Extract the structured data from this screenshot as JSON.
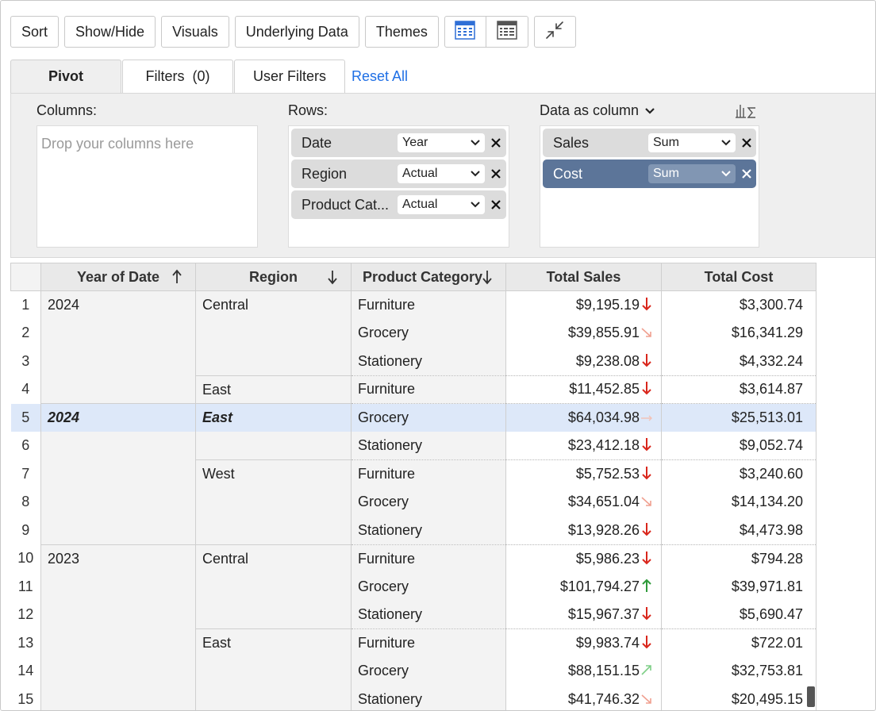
{
  "toolbar": {
    "sort": "Sort",
    "show_hide": "Show/Hide",
    "visuals": "Visuals",
    "underlying_data": "Underlying Data",
    "themes": "Themes",
    "icons": [
      "pivot-table-view-icon",
      "tabular-view-icon",
      "collapse-icon"
    ]
  },
  "tabs": {
    "pivot": "Pivot",
    "filters": "Filters  (0)",
    "user_filters": "User Filters",
    "reset_all": "Reset All"
  },
  "zones": {
    "columns_label": "Columns:",
    "columns_placeholder": "Drop your columns here",
    "rows_label": "Rows:",
    "rows": [
      {
        "name": "Date",
        "func": "Year"
      },
      {
        "name": "Region",
        "func": "Actual"
      },
      {
        "name": "Product Cat...",
        "func": "Actual"
      }
    ],
    "data_label": "Data as column",
    "data": [
      {
        "name": "Sales",
        "func": "Sum",
        "selected": false
      },
      {
        "name": "Cost",
        "func": "Sum",
        "selected": true
      }
    ]
  },
  "table": {
    "headers": [
      "Year of Date",
      "Region",
      "Product Category",
      "Total Sales",
      "Total Cost"
    ],
    "rows": [
      {
        "n": "1",
        "year": "2024",
        "region": "Central",
        "cat": "Furniture",
        "sales": "$9,195.19",
        "trend": "down",
        "cost": "$3,300.74"
      },
      {
        "n": "2",
        "year": "",
        "region": "",
        "cat": "Grocery",
        "sales": "$39,855.91",
        "trend": "slight-down",
        "cost": "$16,341.29"
      },
      {
        "n": "3",
        "year": "",
        "region": "",
        "cat": "Stationery",
        "sales": "$9,238.08",
        "trend": "down",
        "cost": "$4,332.24"
      },
      {
        "n": "4",
        "year": "",
        "region": "East",
        "cat": "Furniture",
        "sales": "$11,452.85",
        "trend": "down",
        "cost": "$3,614.87"
      },
      {
        "n": "5",
        "year": "2024",
        "region": "East",
        "cat": "Grocery",
        "sales": "$64,034.98",
        "trend": "flat",
        "cost": "$25,513.01"
      },
      {
        "n": "6",
        "year": "",
        "region": "",
        "cat": "Stationery",
        "sales": "$23,412.18",
        "trend": "down",
        "cost": "$9,052.74"
      },
      {
        "n": "7",
        "year": "",
        "region": "West",
        "cat": "Furniture",
        "sales": "$5,752.53",
        "trend": "down",
        "cost": "$3,240.60"
      },
      {
        "n": "8",
        "year": "",
        "region": "",
        "cat": "Grocery",
        "sales": "$34,651.04",
        "trend": "slight-down",
        "cost": "$14,134.20"
      },
      {
        "n": "9",
        "year": "",
        "region": "",
        "cat": "Stationery",
        "sales": "$13,928.26",
        "trend": "down",
        "cost": "$4,473.98"
      },
      {
        "n": "10",
        "year": "2023",
        "region": "Central",
        "cat": "Furniture",
        "sales": "$5,986.23",
        "trend": "down",
        "cost": "$794.28"
      },
      {
        "n": "11",
        "year": "",
        "region": "",
        "cat": "Grocery",
        "sales": "$101,794.27",
        "trend": "up",
        "cost": "$39,971.81"
      },
      {
        "n": "12",
        "year": "",
        "region": "",
        "cat": "Stationery",
        "sales": "$15,967.37",
        "trend": "down",
        "cost": "$5,690.47"
      },
      {
        "n": "13",
        "year": "",
        "region": "East",
        "cat": "Furniture",
        "sales": "$9,983.74",
        "trend": "down",
        "cost": "$722.01"
      },
      {
        "n": "14",
        "year": "",
        "region": "",
        "cat": "Grocery",
        "sales": "$88,151.15",
        "trend": "slight-up",
        "cost": "$32,753.81"
      },
      {
        "n": "15",
        "year": "",
        "region": "",
        "cat": "Stationery",
        "sales": "$41,746.32",
        "trend": "slight-down",
        "cost": "$20,495.15"
      }
    ],
    "selected_row": "5"
  },
  "colors": {
    "link": "#1f6fe5",
    "selected_pill": "#5c7599",
    "selected_row": "#dde8f9",
    "trend_down": "#d9261c",
    "trend_slight_down": "#f0a090",
    "trend_up": "#2e9a3a",
    "trend_slight_up": "#7fcf87",
    "trend_flat": "#f2c3b8"
  }
}
